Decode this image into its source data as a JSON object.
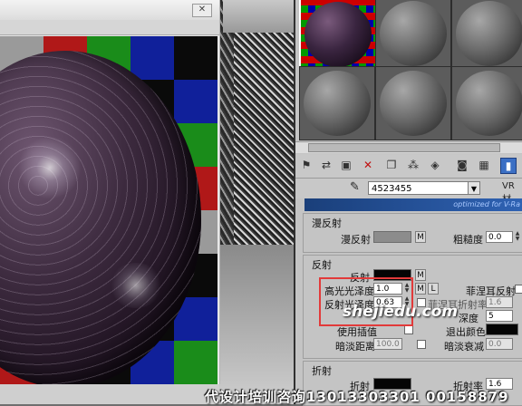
{
  "render_window": {
    "close_label": "✕",
    "checker_colors": [
      "#9a9a9a",
      "#b01818",
      "#1a8c1a",
      "#10209a",
      "#0a0a0a"
    ]
  },
  "material_editor": {
    "material_name": "4523455",
    "material_type": "VR材",
    "banner_text": "optimized for V-Ra",
    "sections": {
      "diffuse_title": "漫反射",
      "diffuse_label": "漫反射",
      "diffuse_m": "M",
      "roughness_label": "粗糙度",
      "roughness_value": "0.0",
      "reflect_title": "反射",
      "reflect_label": "反射",
      "reflect_m": "M",
      "hilight_gloss_label": "高光光泽度",
      "hilight_gloss_value": "1.0",
      "hilight_m": "M",
      "hilight_l": "L",
      "fresnel_label": "菲涅耳反射",
      "refl_gloss_label": "反射光泽度",
      "refl_gloss_value": "0.63",
      "fresnel_ior_label": "菲涅耳折射率",
      "fresnel_ior_value": "1.6",
      "subdivs_label": "深度",
      "subdivs_value": "5",
      "use_interp_label": "使用插值",
      "exit_color_label": "退出颜色",
      "dim_distance_label": "暗淡距离",
      "dim_distance_value": "100.0",
      "dim_falloff_label": "暗淡衰减",
      "dim_falloff_value": "0.0",
      "refract_title": "折射",
      "refract_label": "折射",
      "refract_ior_label": "折射率",
      "refract_ior_value": "1.6"
    }
  },
  "watermark": {
    "url": "shejiedu.com",
    "contact": "代设计培训咨询13013303301 00158879"
  }
}
